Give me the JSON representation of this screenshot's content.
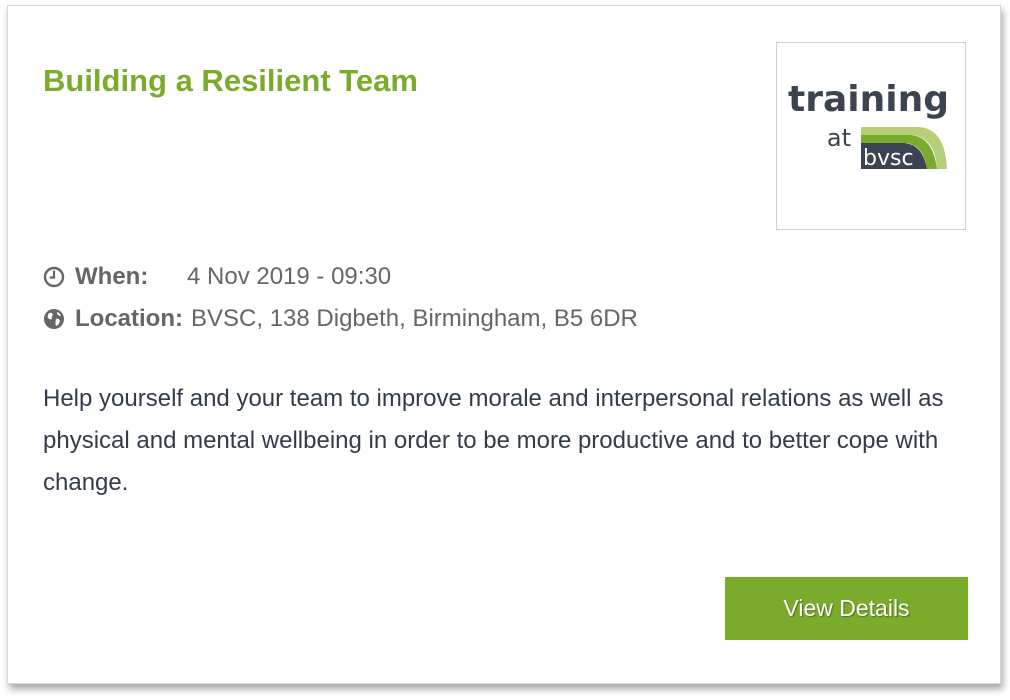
{
  "event": {
    "title": "Building a Resilient Team",
    "when_label": "When:",
    "when_value": "4 Nov 2019 - 09:30",
    "location_label": "Location:",
    "location_value": "BVSC, 138 Digbeth, Birmingham, B5 6DR",
    "description": "Help yourself and your team to improve morale and interpersonal relations as well as physical and mental wellbeing in order to be more productive and to better cope with change.",
    "button_label": "View Details"
  },
  "logo": {
    "word_training": "training",
    "word_at": "at",
    "word_bvsc": "bvsc"
  },
  "icons": {
    "when": "clock-icon",
    "location": "globe-icon"
  },
  "colors": {
    "accent_green": "#7aab2a",
    "light_green": "#b7cf7b",
    "logo_dark": "#3d4451",
    "text_gray": "#666666",
    "body_text": "#333c4a"
  }
}
